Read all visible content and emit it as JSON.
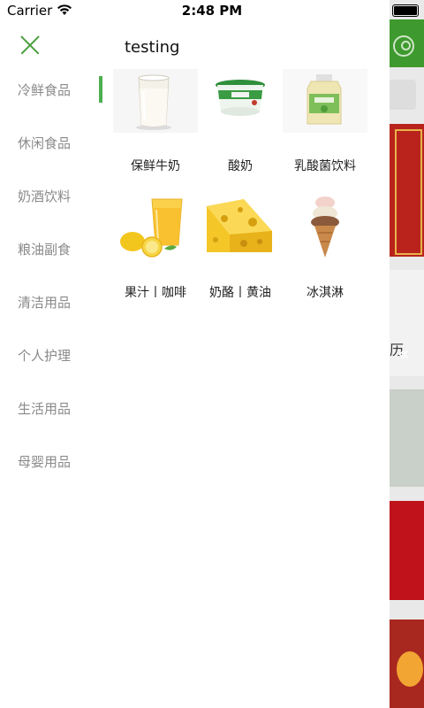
{
  "status_bar": {
    "carrier": "Carrier",
    "time": "2:48 PM"
  },
  "drawer": {
    "title": "testing",
    "categories": [
      {
        "label": "冷鲜食品"
      },
      {
        "label": "休闲食品"
      },
      {
        "label": "奶酒饮料"
      },
      {
        "label": "粮油副食"
      },
      {
        "label": "清洁用品"
      },
      {
        "label": "个人护理"
      },
      {
        "label": "生活用品"
      },
      {
        "label": "母婴用品"
      }
    ],
    "products": [
      {
        "label": "保鲜牛奶",
        "icon": "milk-glass-icon"
      },
      {
        "label": "酸奶",
        "icon": "yogurt-cup-icon"
      },
      {
        "label": "乳酸菌饮料",
        "icon": "probiotic-drink-bottle-icon"
      },
      {
        "label": "果汁丨咖啡",
        "icon": "juice-lemon-icon"
      },
      {
        "label": "奶酪丨黄油",
        "icon": "cheese-icon"
      },
      {
        "label": "冰淇淋",
        "icon": "ice-cream-cone-icon"
      }
    ]
  },
  "background_page": {
    "partial_text": "历"
  },
  "colors": {
    "accent_green": "#4caf50",
    "header_green": "#3e9a2e",
    "category_text": "#8a8a8a"
  }
}
